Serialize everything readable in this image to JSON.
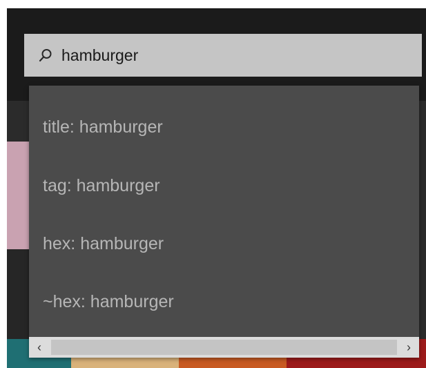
{
  "search": {
    "value": "hamburger",
    "icon": "search-icon"
  },
  "suggestions": [
    {
      "label": "title: hamburger"
    },
    {
      "label": "tag: hamburger"
    },
    {
      "label": "hex: hamburger"
    },
    {
      "label": "~hex: hamburger"
    }
  ],
  "scrollbar": {
    "left_glyph": "‹",
    "right_glyph": "›"
  },
  "colors": {
    "app_background": "#1e1e1e",
    "search_background": "#c5c5c5",
    "dropdown_background": "#4b4b4b",
    "suggestion_text": "#b6b6b6",
    "pink_swatch": "#c9a2b1",
    "palette": [
      "#1f6f73",
      "#d9b27a",
      "#c85a22",
      "#9c1a1a"
    ]
  }
}
